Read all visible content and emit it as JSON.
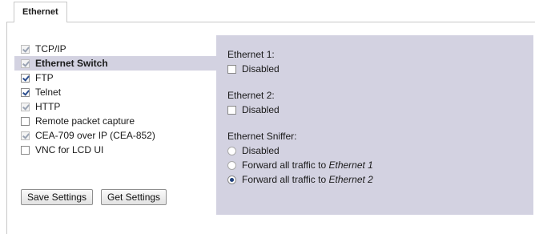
{
  "tabs": [
    {
      "label": "Ethernet"
    }
  ],
  "services": [
    {
      "label": "TCP/IP",
      "checked": true,
      "disabled": true
    },
    {
      "label": "Ethernet Switch",
      "checked": true,
      "disabled": true,
      "selected": true
    },
    {
      "label": "FTP",
      "checked": true,
      "disabled": false
    },
    {
      "label": "Telnet",
      "checked": true,
      "disabled": false
    },
    {
      "label": "HTTP",
      "checked": true,
      "disabled": true
    },
    {
      "label": "Remote packet capture",
      "checked": false,
      "disabled": false
    },
    {
      "label": "CEA-709 over IP (CEA-852)",
      "checked": true,
      "disabled": true
    },
    {
      "label": "VNC for LCD UI",
      "checked": false,
      "disabled": false
    }
  ],
  "buttons": {
    "save_label": "Save Settings",
    "get_label": "Get Settings"
  },
  "panel": {
    "ethernet1": {
      "heading": "Ethernet 1:",
      "option_label": "Disabled",
      "checked": false
    },
    "ethernet2": {
      "heading": "Ethernet 2:",
      "option_label": "Disabled",
      "checked": false
    },
    "sniffer": {
      "heading": "Ethernet Sniffer:",
      "options": [
        {
          "prefix": "Disabled",
          "target": "",
          "selected": false
        },
        {
          "prefix": "Forward all traffic to ",
          "target": "Ethernet 1",
          "selected": false
        },
        {
          "prefix": "Forward all traffic to ",
          "target": "Ethernet 2",
          "selected": true
        }
      ]
    }
  },
  "colors": {
    "panel_bg": "#d3d2e1",
    "border": "#c8c8c8"
  }
}
